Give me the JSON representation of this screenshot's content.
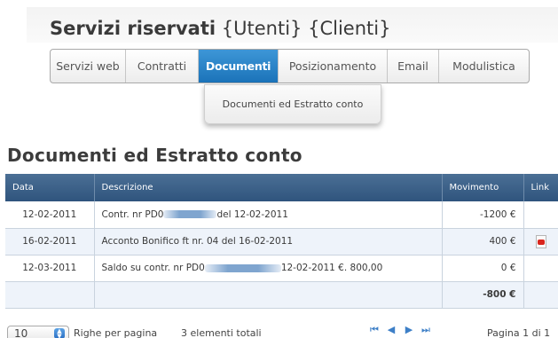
{
  "header": {
    "title_bold": "Servizi riservati",
    "title_tags": "{Utenti} {Clienti}"
  },
  "nav": {
    "tabs": [
      {
        "label": "Servizi web"
      },
      {
        "label": "Contratti"
      },
      {
        "label": "Documenti",
        "active": true
      },
      {
        "label": "Posizionamento"
      },
      {
        "label": "Email"
      },
      {
        "label": "Modulistica"
      }
    ],
    "dropdown_item": "Documenti ed Estratto conto"
  },
  "page_title": "Documenti ed Estratto conto",
  "table": {
    "headers": [
      "Data",
      "Descrizione",
      "Movimento",
      "Link"
    ],
    "rows": [
      {
        "data": "12-02-2011",
        "desc_a": "Contr. nr PD0",
        "desc_b": "del 12-02-2011",
        "movimento": "-1200 €",
        "link": ""
      },
      {
        "data": "16-02-2011",
        "desc_a": "Acconto Bonifico ft nr. 04 del 16-02-2011",
        "desc_b": "",
        "movimento": "400 €",
        "link": "pdf-icon"
      },
      {
        "data": "12-03-2011",
        "desc_a": "Saldo su contr. nr PD0",
        "desc_b": "12-02-2011 €. 800,00",
        "movimento": "0 €",
        "link": ""
      },
      {
        "data": "",
        "desc_a": "",
        "desc_b": "",
        "movimento": "-800 €",
        "link": ""
      }
    ]
  },
  "pager": {
    "per_page_value": "10",
    "per_page_label": "Righe per pagina",
    "total_label": "3 elementi totali",
    "page_label": "Pagina 1 di 1"
  },
  "colors": {
    "accent": "#1b73b9",
    "table_header": "#2f547d",
    "row_alt": "#eef3fa"
  }
}
